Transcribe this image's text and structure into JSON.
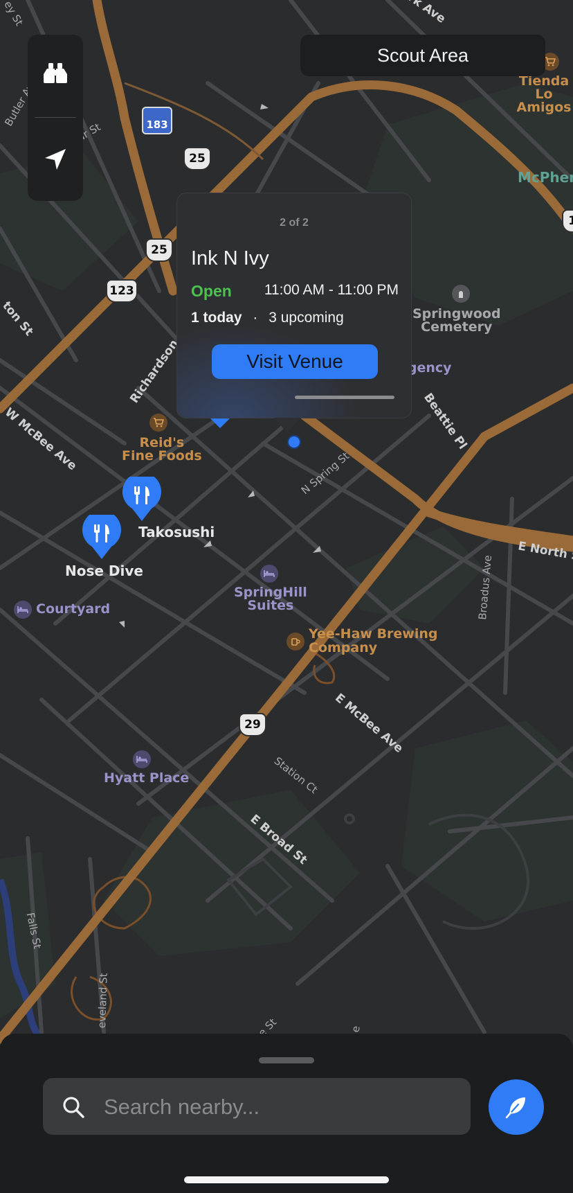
{
  "colors": {
    "map_bg": "#2b2c2e",
    "road_major": "#9a6b38",
    "road_minor": "#45474a",
    "accent": "#2f7cf6",
    "open_green": "#4cc24f"
  },
  "map_labels": {
    "scout_area_button": "Scout Area",
    "pois": {
      "tienda": "Tienda Lo\nAmigos",
      "mcpherson": "McPhers",
      "springwood": "Springwood\nCemetery",
      "regency": "egency",
      "reids": "Reid's\nFine Foods",
      "takosushi": "Takosushi",
      "nose_dive": "Nose Dive",
      "courtyard": "Courtyard",
      "springhill": "SpringHill\nSuites",
      "yeehaw": "Yee-Haw Brewing\nCompany",
      "hyatt": "Hyatt Place"
    },
    "streets": {
      "ey_st": "ey St",
      "butler": "Butler Ave",
      "altmar": "ltmar St",
      "rk_ave": "rk Ave",
      "ton_st": "ton St",
      "w_mcbee": "W McBee Ave",
      "richardson": "Richardson",
      "n_spring": "N Spring St",
      "beattie": "Beattie Pl",
      "e_north": "E North S",
      "broadus": "Broadus Ave",
      "e_mcbee": "E McBee Ave",
      "station": "Station Ct",
      "e_broad": "E Broad St",
      "falls": "Falls St",
      "cleveland": "eveland St",
      "bottom_st": "e St",
      "bottom_e": "e"
    },
    "shields": {
      "sr183": "183",
      "us25_a": "25",
      "us25_b": "25",
      "us123": "123",
      "us29": "29",
      "edge": "1"
    }
  },
  "callout": {
    "pager": "2 of 2",
    "venue_name": "Ink N Ivy",
    "status": "Open",
    "hours": "11:00 AM - 11:00 PM",
    "today_count": "1 today",
    "separator": "·",
    "upcoming": "3 upcoming",
    "visit_button": "Visit Venue"
  },
  "toolbar": {
    "explore_icon": "binoculars-icon",
    "locate_icon": "location-arrow-icon"
  },
  "search": {
    "placeholder": "Search nearby...",
    "value": ""
  },
  "compose_icon": "feather-icon"
}
